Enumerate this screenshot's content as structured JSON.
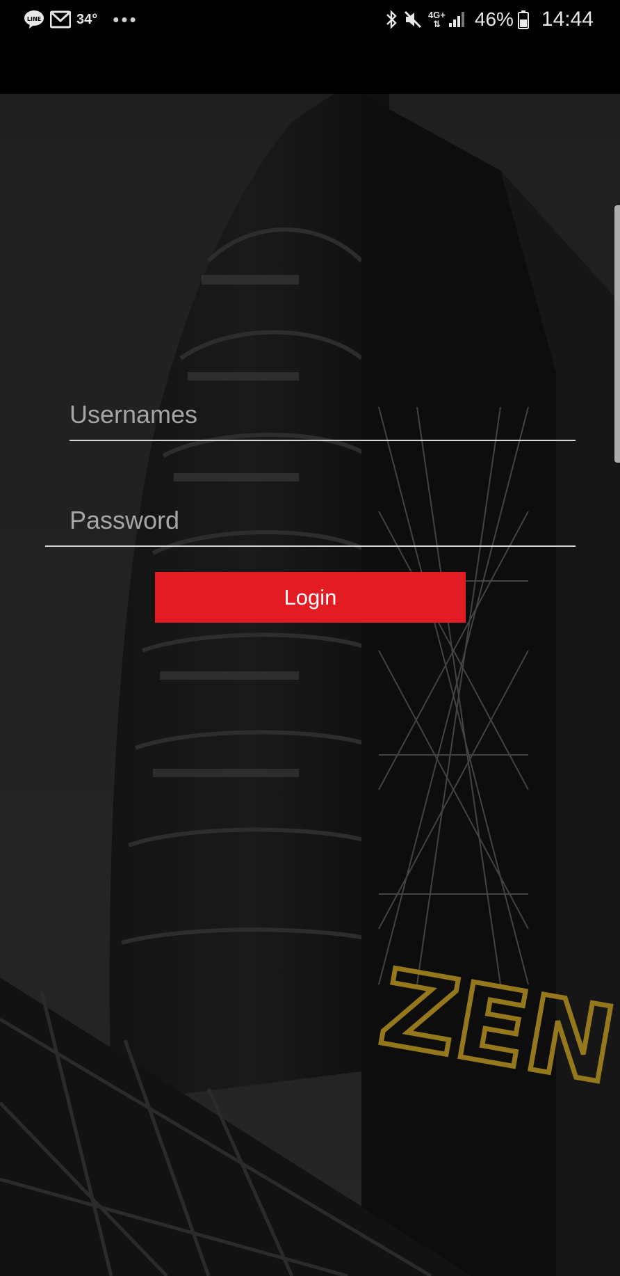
{
  "status_bar": {
    "temperature": "34°",
    "overflow_dots": "•••",
    "network_type": "4G+",
    "battery_percent": "46%",
    "time": "14:44",
    "icons": [
      "line-icon",
      "gmail-icon",
      "bluetooth-icon",
      "mute-icon",
      "signal-icon",
      "battery-icon"
    ]
  },
  "login_form": {
    "username_placeholder": "Usernames",
    "password_placeholder": "Password",
    "login_label": "Login"
  },
  "background": {
    "sign_text": "ZEN"
  },
  "colors": {
    "accent": "#e31b23",
    "status_bar": "#000000",
    "input_line": "#d8d8d8",
    "placeholder": "#a6a6a6"
  }
}
